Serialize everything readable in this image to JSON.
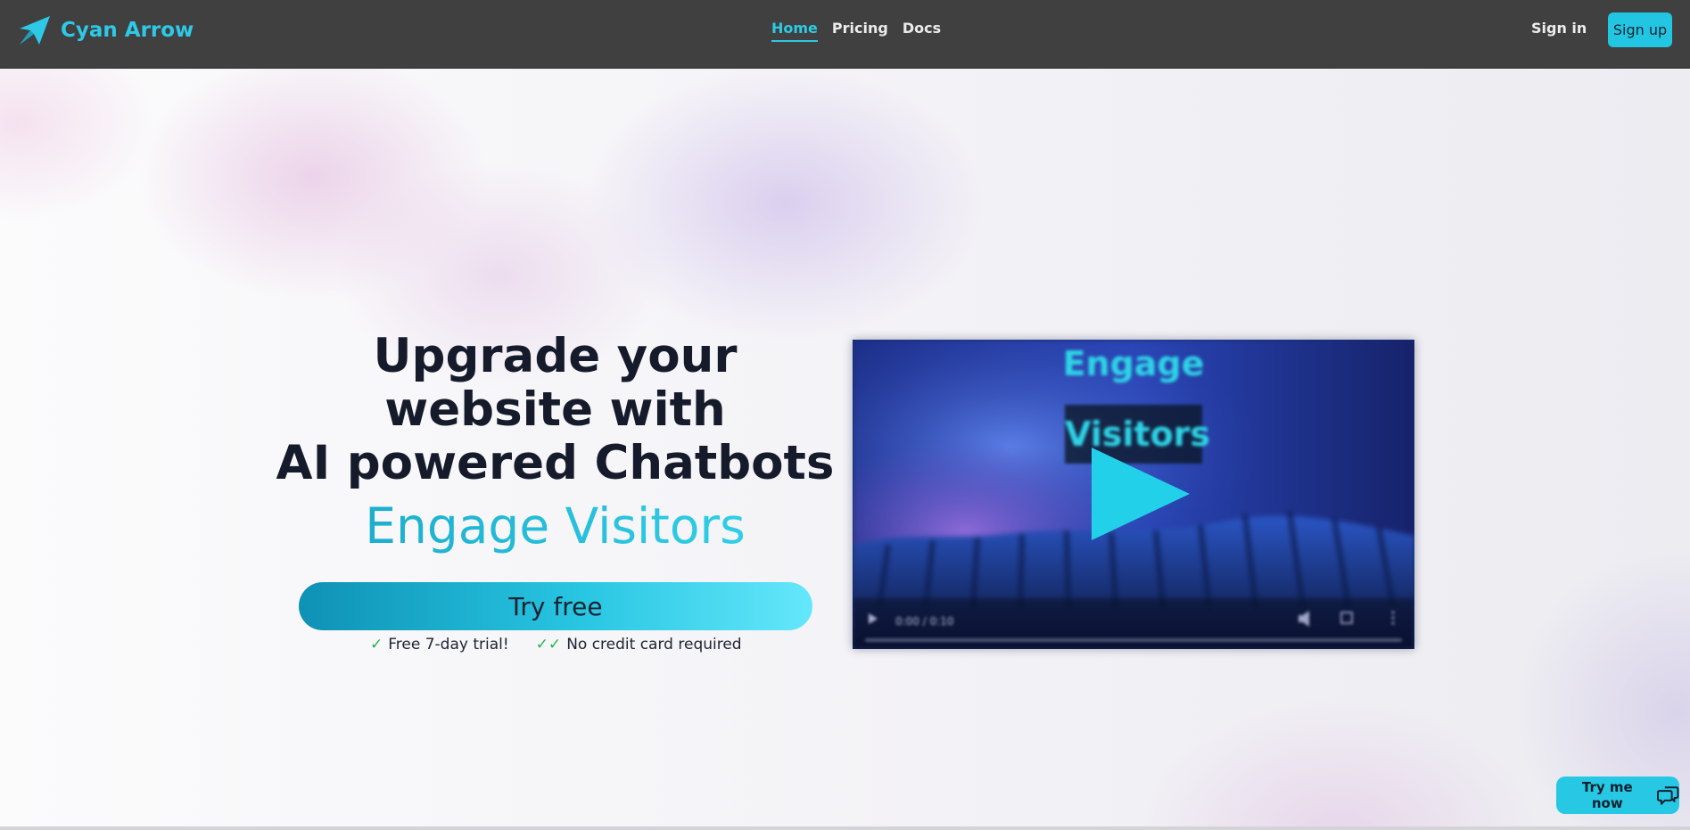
{
  "nav": {
    "brand": "Cyan Arrow",
    "links": [
      "Home",
      "Pricing",
      "Docs"
    ],
    "active": "Home",
    "sign_in": "Sign in",
    "sign_up": "Sign up"
  },
  "hero": {
    "headline": [
      "Upgrade your",
      "website with",
      "AI powered Chatbots"
    ],
    "subheadline": "Engage Visitors",
    "cta": "Try free",
    "perks": [
      {
        "check": "✓",
        "text": "Free 7-day trial!"
      },
      {
        "check": "✓✓",
        "text": "No credit card required"
      }
    ]
  },
  "video": {
    "title_line1": "Engage",
    "title_line2": "Visitors",
    "time": "0:00 / 0:10"
  },
  "chat_widget": {
    "label": "Try me now"
  },
  "colors": {
    "accent": "#22c6e2",
    "navbar": "#404040",
    "headline": "#161b2b",
    "check": "#22b34a"
  },
  "icons": [
    "brand-arrow-icon",
    "play-icon",
    "chat-bubble-icon",
    "volume-icon",
    "fullscreen-icon",
    "more-icon"
  ]
}
